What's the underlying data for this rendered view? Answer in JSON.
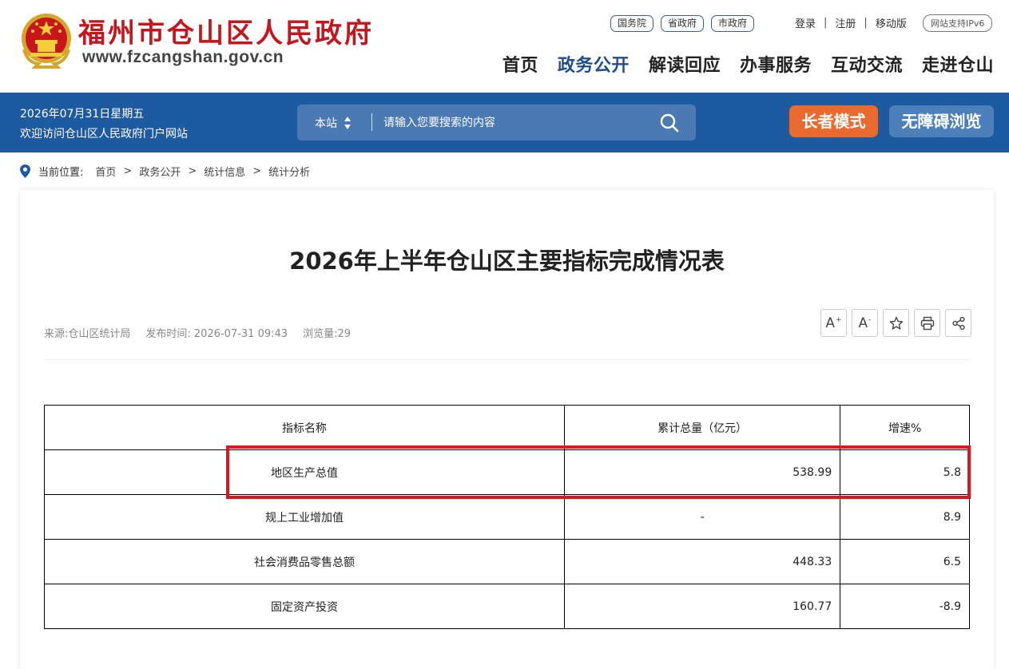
{
  "header": {
    "site_title": "福州市仓山区人民政府",
    "site_domain": "www.fzcangshan.gov.cn",
    "gov_links": [
      "国务院",
      "省政府",
      "市政府"
    ],
    "user_links": [
      "登录",
      "注册",
      "移动版"
    ],
    "ipv6_badge": "网站支持IPv6",
    "nav": [
      "首页",
      "政务公开",
      "解读回应",
      "办事服务",
      "互动交流",
      "走进仓山"
    ],
    "active_nav": "政务公开"
  },
  "bluebar": {
    "date": "2026年07月31日星期五",
    "welcome": "欢迎访问仓山区人民政府门户网站",
    "search_scope": "本站",
    "search_placeholder": "请输入您要搜索的内容",
    "elder_mode": "长者模式",
    "accessible": "无障碍浏览"
  },
  "breadcrumb": {
    "label": "当前位置:",
    "items": [
      "首页",
      "政务公开",
      "统计信息",
      "统计分析"
    ]
  },
  "article": {
    "title": "2026年上半年仓山区主要指标完成情况表",
    "source": "来源:仓山区统计局",
    "publish_time": "发布时间: 2026-07-31 09:43",
    "views": "浏览量:29",
    "tools": [
      "A+",
      "A-",
      "star-icon",
      "print-icon",
      "share-icon"
    ]
  },
  "table": {
    "headers": [
      "指标名称",
      "累计总量（亿元）",
      "增速%"
    ],
    "rows": [
      {
        "name": "地区生产总值",
        "total": "538.99",
        "growth": "5.8"
      },
      {
        "name": "规上工业增加值",
        "total": "-",
        "growth": "8.9"
      },
      {
        "name": "社会消费品零售总额",
        "total": "448.33",
        "growth": "6.5"
      },
      {
        "name": "固定资产投资",
        "total": "160.77",
        "growth": "-8.9"
      }
    ],
    "highlight_color": "#e0141e"
  },
  "colors": {
    "brand_red": "#c4161c",
    "nav_blue": "#1e5a9f",
    "elder_orange": "#e86a2e"
  }
}
